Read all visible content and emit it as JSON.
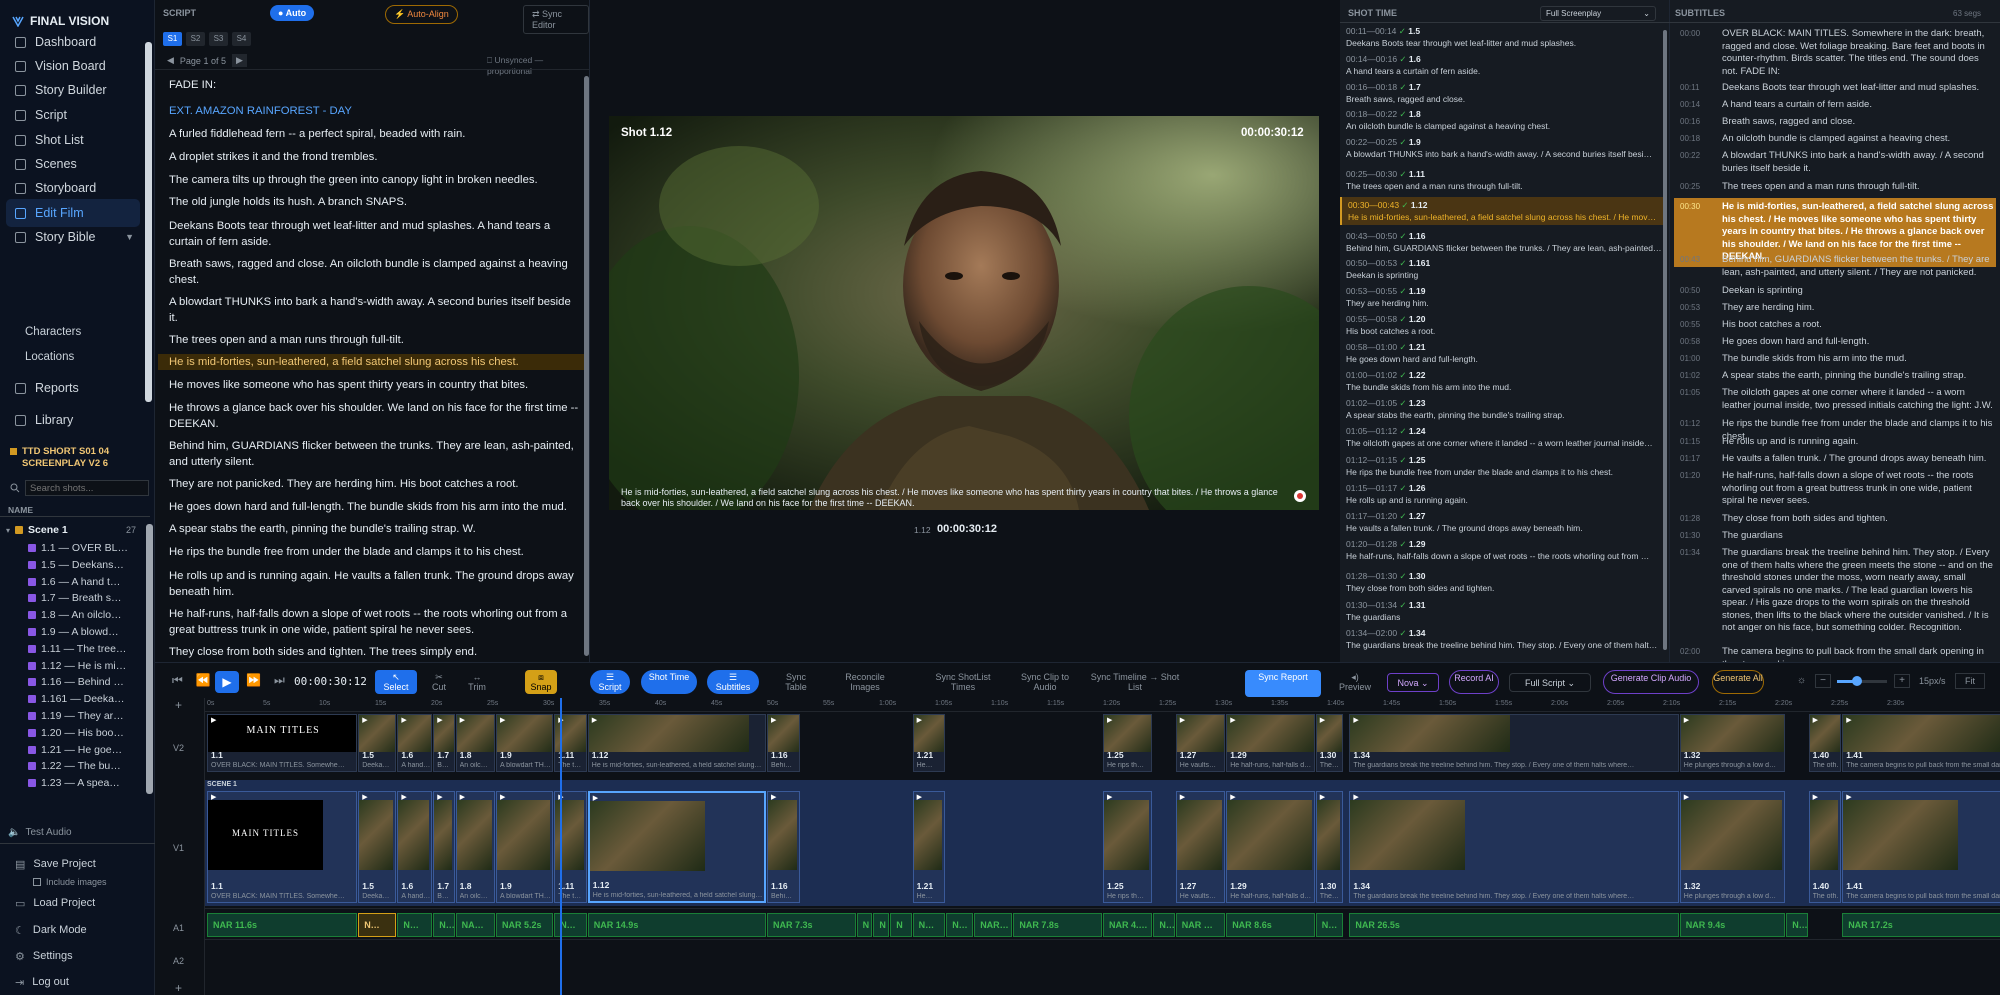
{
  "app": {
    "name": "FINAL VISION"
  },
  "sidebar": {
    "nav": [
      {
        "label": "Dashboard",
        "icon": "dashboard-icon"
      },
      {
        "label": "Vision Board",
        "icon": "board-icon"
      },
      {
        "label": "Story Builder",
        "icon": "book-icon"
      },
      {
        "label": "Script",
        "icon": "document-icon"
      },
      {
        "label": "Shot List",
        "icon": "list-icon"
      },
      {
        "label": "Scenes",
        "icon": "layers-icon"
      },
      {
        "label": "Storyboard",
        "icon": "storyboard-icon"
      },
      {
        "label": "Edit Film",
        "icon": "film-icon"
      },
      {
        "label": "Story Bible",
        "icon": "bible-icon"
      }
    ],
    "story_bible_children": [
      "Characters",
      "Locations"
    ],
    "nav2": [
      {
        "label": "Reports",
        "icon": "chart-icon"
      },
      {
        "label": "Library",
        "icon": "library-icon"
      }
    ],
    "project_line1": "TTD SHORT S01 04",
    "project_line2": "SCREENPLAY V2 6",
    "search_placeholder": "Search shots...",
    "tree_header": "NAME",
    "scene": {
      "label": "Scene 1",
      "count": "27"
    },
    "tree_items": [
      "1.1 — OVER BL…",
      "1.5 — Deekans…",
      "1.6 — A hand t…",
      "1.7 — Breath s…",
      "1.8 — An oilclo…",
      "1.9 — A blowd…",
      "1.11 — The tree…",
      "1.12 — He is mi…",
      "1.16 — Behind …",
      "1.161 — Deeka…",
      "1.19 — They ar…",
      "1.20 — His boo…",
      "1.21 — He goe…",
      "1.22 — The bu…",
      "1.23 — A spea…"
    ],
    "test_audio": "Test Audio",
    "save_project": "Save Project",
    "include_images": "Include images",
    "load_project": "Load Project",
    "dark_mode": "Dark Mode",
    "settings": "Settings",
    "logout": "Log out"
  },
  "script": {
    "header": "SCRIPT",
    "auto": "Auto",
    "auto_align": "Auto-Align",
    "sync_editor": "Sync Editor",
    "tabs": [
      "S1",
      "S2",
      "S3",
      "S4"
    ],
    "page_label": "Page 1 of 5",
    "sync_status": "Unsynced — proportional",
    "lines": [
      "FADE IN:",
      "EXT. AMAZON RAINFOREST - DAY",
      "A furled fiddlehead fern -- a perfect spiral, beaded with rain.",
      "A droplet strikes it and the frond trembles.",
      "The camera tilts up through the green into canopy light in broken needles.",
      "The old jungle holds its hush.   A branch SNAPS.",
      "Deekans Boots tear through wet leaf-litter and mud splashes.    A hand tears a curtain of fern aside.",
      "Breath saws, ragged and close.   An oilcloth bundle is clamped against a heaving chest.",
      "A blowdart THUNKS into bark a hand's-width away.    A second buries itself beside it.",
      "The trees open and a man runs through full-tilt.",
      "He is mid-forties, sun-leathered, a field satchel slung across his chest.",
      "He moves like someone who has spent thirty years in country that bites.",
      "He throws a glance back over his shoulder.    We land on his face for the first time -- DEEKAN.",
      "Behind him, GUARDIANS flicker between the trunks.   They are lean, ash-painted, and utterly silent.",
      "They are not panicked.   They are herding him.   His boot catches a root.",
      "He goes down hard and full-length.   The bundle skids from his arm into the mud.",
      "A spear stabs the earth, pinning the bundle's trailing strap.    W.",
      "He rips the bundle free from under the blade and clamps it to his chest.",
      "He rolls up and is running again.   He vaults a fallen trunk.   The ground drops away beneath him.",
      "He half-runs, half-falls down a slope of wet roots -- the roots whorling out from a great buttress trunk in one wide, patient spiral he never sees.",
      "They close from both sides and tighten.    The trees simply end."
    ]
  },
  "video": {
    "shot_label": "Shot 1.12",
    "timecode": "00:00:30:12",
    "caption": "He is mid-forties, sun-leathered, a field satchel slung across his chest. / He moves like someone who has spent thirty years in country that bites. / He throws a glance back over his shoulder. / We land on his face for the first time -- DEEKAN.",
    "footer_shot": "1.12",
    "footer_timecode": "00:00:30:12"
  },
  "shots": {
    "header": "SHOT TIME",
    "dropdown": "Full Screenplay",
    "items": [
      {
        "tc": "00:11—00:14",
        "id": "1.5",
        "text": "Deekans Boots tear through wet leaf-litter and mud splashes."
      },
      {
        "tc": "00:14—00:16",
        "id": "1.6",
        "text": "A hand tears a curtain of fern aside."
      },
      {
        "tc": "00:16—00:18",
        "id": "1.7",
        "text": "Breath saws, ragged and close."
      },
      {
        "tc": "00:18—00:22",
        "id": "1.8",
        "text": "An oilcloth bundle is clamped against a heaving chest."
      },
      {
        "tc": "00:22—00:25",
        "id": "1.9",
        "text": "A blowdart THUNKS into bark a hand's-width away. / A second buries itself besi…"
      },
      {
        "tc": "00:25—00:30",
        "id": "1.11",
        "text": "The trees open and a man runs through full-tilt."
      },
      {
        "tc": "00:30—00:43",
        "id": "1.12",
        "text": "He is mid-forties, sun-leathered, a field satchel slung across his chest. / He mov…"
      },
      {
        "tc": "00:43—00:50",
        "id": "1.16",
        "text": "Behind him, GUARDIANS flicker between the trunks. / They are lean, ash-painted…"
      },
      {
        "tc": "00:50—00:53",
        "id": "1.161",
        "text": "Deekan is sprinting"
      },
      {
        "tc": "00:53—00:55",
        "id": "1.19",
        "text": "They are herding him."
      },
      {
        "tc": "00:55—00:58",
        "id": "1.20",
        "text": "His boot catches a root."
      },
      {
        "tc": "00:58—01:00",
        "id": "1.21",
        "text": "He goes down hard and full-length."
      },
      {
        "tc": "01:00—01:02",
        "id": "1.22",
        "text": "The bundle skids from his arm into the mud."
      },
      {
        "tc": "01:02—01:05",
        "id": "1.23",
        "text": "A spear stabs the earth, pinning the bundle's trailing strap."
      },
      {
        "tc": "01:05—01:12",
        "id": "1.24",
        "text": "The oilcloth gapes at one corner where it landed -- a worn leather journal inside…"
      },
      {
        "tc": "01:12—01:15",
        "id": "1.25",
        "text": "He rips the bundle free from under the blade and clamps it to his chest."
      },
      {
        "tc": "01:15—01:17",
        "id": "1.26",
        "text": "He rolls up and is running again."
      },
      {
        "tc": "01:17—01:20",
        "id": "1.27",
        "text": "He vaults a fallen trunk. / The ground drops away beneath him."
      },
      {
        "tc": "01:20—01:28",
        "id": "1.29",
        "text": "He half-runs, half-falls down a slope of wet roots -- the roots whorling out from …"
      },
      {
        "tc": "01:28—01:30",
        "id": "1.30",
        "text": "They close from both sides and tighten."
      },
      {
        "tc": "01:30—01:34",
        "id": "1.31",
        "text": "The guardians"
      },
      {
        "tc": "01:34—02:00",
        "id": "1.34",
        "text": "The guardians break the treeline behind him. They stop. / Every one of them halt…"
      }
    ]
  },
  "subtitles": {
    "header": "SUBTITLES",
    "count": "63 segs",
    "items": [
      {
        "tc": "00:00",
        "text": "OVER BLACK: MAIN TITLES. Somewhere in the dark: breath, ragged and close. Wet foliage breaking. Bare feet and boots in counter-rhythm. Birds scatter. The titles end. The sound does not. FADE IN:"
      },
      {
        "tc": "00:11",
        "text": "Deekans Boots tear through wet leaf-litter and mud splashes."
      },
      {
        "tc": "00:14",
        "text": "A hand tears a curtain of fern aside."
      },
      {
        "tc": "00:16",
        "text": "Breath saws, ragged and close."
      },
      {
        "tc": "00:18",
        "text": "An oilcloth bundle is clamped against a heaving chest."
      },
      {
        "tc": "00:22",
        "text": "A blowdart THUNKS into bark a hand's-width away. / A second buries itself beside it."
      },
      {
        "tc": "00:25",
        "text": "The trees open and a man runs through full-tilt."
      },
      {
        "tc": "00:30",
        "text": "He is mid-forties, sun-leathered, a field satchel slung across his chest. / He moves like someone who has spent thirty years in country that bites. / He throws a glance back over his shoulder. / We land on his face for the first time -- DEEKAN."
      },
      {
        "tc": "00:43",
        "text": "Behind him, GUARDIANS flicker between the trunks. / They are lean, ash-painted, and utterly silent. / They are not panicked."
      },
      {
        "tc": "00:50",
        "text": "Deekan is sprinting"
      },
      {
        "tc": "00:53",
        "text": "They are herding him."
      },
      {
        "tc": "00:55",
        "text": "His boot catches a root."
      },
      {
        "tc": "00:58",
        "text": "He goes down hard and full-length."
      },
      {
        "tc": "01:00",
        "text": "The bundle skids from his arm into the mud."
      },
      {
        "tc": "01:02",
        "text": "A spear stabs the earth, pinning the bundle's trailing strap."
      },
      {
        "tc": "01:05",
        "text": "The oilcloth gapes at one corner where it landed -- a worn leather journal inside, two pressed initials catching the light: J.W."
      },
      {
        "tc": "01:12",
        "text": "He rips the bundle free from under the blade and clamps it to his chest."
      },
      {
        "tc": "01:15",
        "text": "He rolls up and is running again."
      },
      {
        "tc": "01:17",
        "text": "He vaults a fallen trunk. / The ground drops away beneath him."
      },
      {
        "tc": "01:20",
        "text": "He half-runs, half-falls down a slope of wet roots -- the roots whorling out from a great buttress trunk in one wide, patient spiral he never sees."
      },
      {
        "tc": "01:28",
        "text": "They close from both sides and tighten."
      },
      {
        "tc": "01:30",
        "text": "The guardians"
      },
      {
        "tc": "01:34",
        "text": "The guardians break the treeline behind him. They stop. / Every one of them halts where the green meets the stone -- and on the threshold stones under the moss, worn nearly away, small carved spirals no one marks. / The lead guardian lowers his spear. / His gaze drops to the worn spirals on the threshold stones, then lifts to the black where the outsider vanished. / It is not anger on his face, but something colder. Recognition."
      },
      {
        "tc": "02:00",
        "text": "The camera begins to pull back from the small dark opening in the stone and is gone."
      }
    ]
  },
  "toolbar": {
    "timecode": "00:00:30:12",
    "select": "Select",
    "cut": "Cut",
    "trim": "Trim",
    "snap": "Snap",
    "script": "Script",
    "shot_time": "Shot Time",
    "subtitles": "Subtitles",
    "sync_table": "Sync Table",
    "reconcile": "Reconcile Images",
    "sync_shotlist": "Sync ShotList Times",
    "sync_clip": "Sync Clip to Audio",
    "sync_timeline": "Sync Timeline → Shot List",
    "sync_report": "Sync Report",
    "preview": "Preview",
    "voice": "Nova",
    "record": "Record AI",
    "scope": "Full Script",
    "gen_clip": "Generate Clip Audio",
    "gen_all": "Generate All",
    "fps": "15px/s",
    "fit": "Fit"
  },
  "timeline": {
    "ruler": [
      "0s",
      "5s",
      "10s",
      "15s",
      "20s",
      "25s",
      "30s",
      "35s",
      "40s",
      "45s",
      "50s",
      "55s",
      "1:00s",
      "1:05s",
      "1:10s",
      "1:15s",
      "1:20s",
      "1:25s",
      "1:30s",
      "1:35s",
      "1:40s",
      "1:45s",
      "1:50s",
      "1:55s",
      "2:00s",
      "2:05s",
      "2:10s",
      "2:15s",
      "2:20s",
      "2:25s",
      "2:30s"
    ],
    "tracks": [
      "V2",
      "V1",
      "A1",
      "A2"
    ],
    "scene_label": "SCENE 1",
    "main_titles": "MAIN TITLES",
    "clips": [
      {
        "id": "1.1",
        "desc": "OVER BLACK: MAIN TITLES. Somewhe…",
        "start": 0,
        "end": 13.5
      },
      {
        "id": "1.5",
        "desc": "Deeka…",
        "start": 13.5,
        "end": 17
      },
      {
        "id": "1.6",
        "desc": "A hand…",
        "start": 17,
        "end": 20.2
      },
      {
        "id": "1.7",
        "desc": "B…",
        "start": 20.2,
        "end": 22.2
      },
      {
        "id": "1.8",
        "desc": "An oilc…",
        "start": 22.2,
        "end": 25.8
      },
      {
        "id": "1.9",
        "desc": "A blowdart TH…",
        "start": 25.8,
        "end": 31
      },
      {
        "id": "1.11",
        "desc": "The t…",
        "start": 31,
        "end": 34
      },
      {
        "id": "1.12",
        "desc": "He is mid-forties, sun-leathered, a field satchel slung…",
        "start": 34,
        "end": 50
      },
      {
        "id": "1.16",
        "desc": "Behi…",
        "start": 50,
        "end": 53
      },
      {
        "id": "1.21",
        "desc": "He…",
        "start": 63,
        "end": 66
      },
      {
        "id": "1.25",
        "desc": "He rips th…",
        "start": 80,
        "end": 84.5
      },
      {
        "id": "1.27",
        "desc": "He vaults…",
        "start": 86.5,
        "end": 91
      },
      {
        "id": "1.29",
        "desc": "He half-runs, half-falls d…",
        "start": 91,
        "end": 99
      },
      {
        "id": "1.30",
        "desc": "The…",
        "start": 99,
        "end": 101.5
      },
      {
        "id": "1.34",
        "desc": "The guardians break the treeline behind him. They stop. / Every one of them halts where…",
        "start": 102,
        "end": 131.5
      },
      {
        "id": "1.32",
        "desc": "He plunges through a low d…",
        "start": 131.5,
        "end": 141
      },
      {
        "id": "1.40",
        "desc": "The oth…",
        "start": 143,
        "end": 146
      },
      {
        "id": "1.41",
        "desc": "The camera begins to pull back from the small dark opening…",
        "start": 146,
        "end": 161
      }
    ],
    "audio": [
      {
        "label": "NAR 11.6s",
        "start": 0,
        "end": 13.5,
        "hl": false
      },
      {
        "label": "N…",
        "start": 13.5,
        "end": 17,
        "hl": true
      },
      {
        "label": "N…",
        "start": 17,
        "end": 20.2,
        "hl": false
      },
      {
        "label": "N…",
        "start": 20.2,
        "end": 22.2,
        "hl": false
      },
      {
        "label": "NA…",
        "start": 22.2,
        "end": 25.8,
        "hl": false
      },
      {
        "label": "NAR 5.2s",
        "start": 25.8,
        "end": 31,
        "hl": false
      },
      {
        "label": "N…",
        "start": 31,
        "end": 34,
        "hl": false
      },
      {
        "label": "NAR 14.9s",
        "start": 34,
        "end": 50,
        "hl": false
      },
      {
        "label": "NAR 7.3s",
        "start": 50,
        "end": 58,
        "hl": false
      },
      {
        "label": "N",
        "start": 58,
        "end": 59.5,
        "hl": false
      },
      {
        "label": "N",
        "start": 59.5,
        "end": 61,
        "hl": false
      },
      {
        "label": "N",
        "start": 61,
        "end": 63,
        "hl": false
      },
      {
        "label": "N…",
        "start": 63,
        "end": 66,
        "hl": false
      },
      {
        "label": "N…",
        "start": 66,
        "end": 68.5,
        "hl": false
      },
      {
        "label": "NAR…",
        "start": 68.5,
        "end": 72,
        "hl": false
      },
      {
        "label": "NAR 7.8s",
        "start": 72,
        "end": 80,
        "hl": false
      },
      {
        "label": "NAR 4.…",
        "start": 80,
        "end": 84.5,
        "hl": false
      },
      {
        "label": "N…",
        "start": 84.5,
        "end": 86.5,
        "hl": false
      },
      {
        "label": "NAR …",
        "start": 86.5,
        "end": 91,
        "hl": false
      },
      {
        "label": "NAR 8.6s",
        "start": 91,
        "end": 99,
        "hl": false
      },
      {
        "label": "N…",
        "start": 99,
        "end": 101.5,
        "hl": false
      },
      {
        "label": "NAR 26.5s",
        "start": 102,
        "end": 131.5,
        "hl": false
      },
      {
        "label": "NAR 9.4s",
        "start": 131.5,
        "end": 141,
        "hl": false
      },
      {
        "label": "N…",
        "start": 141,
        "end": 143,
        "hl": false
      },
      {
        "label": "NAR 17.2s",
        "start": 146,
        "end": 161,
        "hl": false
      }
    ]
  }
}
